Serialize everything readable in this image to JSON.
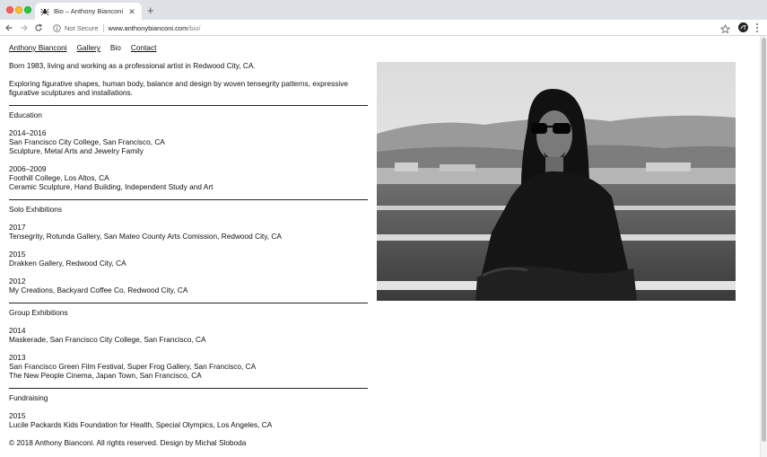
{
  "browser": {
    "tab_title": "Bio – Anthony Bianconi",
    "security_label": "Not Secure",
    "url_host": "www.anthonybianconi.com",
    "url_path": "/bio/"
  },
  "site": {
    "nav": {
      "home": "Anthony Bianconi",
      "gallery": "Gallery",
      "bio": "Bio",
      "contact": "Contact"
    },
    "intro": {
      "line1": "Born 1983, living and working as a professional artist in Redwood City, CA.",
      "line2": "Exploring figurative shapes, human body, balance and design by woven tensegrity patterns, expressive figurative sculptures and installations."
    },
    "education": {
      "heading": "Education",
      "entries": [
        {
          "years": "2014–2016",
          "school": "San Francisco City College, San Francisco, CA",
          "detail": "Sculpture, Metal Arts and Jewelry Family"
        },
        {
          "years": "2006–2009",
          "school": "Foothill College, Los Altos, CA",
          "detail": "Ceramic Sculpture, Hand Building, Independent Study and Art"
        }
      ]
    },
    "solo": {
      "heading": "Solo Exhibitions",
      "entries": [
        {
          "year": "2017",
          "item": "Tensegrity, Rotunda Gallery, San Mateo County Arts Comission, Redwood City, CA"
        },
        {
          "year": "2015",
          "item": "Drakken Gallery, Redwood City, CA"
        },
        {
          "year": "2012",
          "item": "My Creations, Backyard Coffee Co, Redwood City, CA"
        }
      ]
    },
    "group": {
      "heading": "Group Exhibitions",
      "entries": [
        {
          "year": "2014",
          "items": [
            "Maskerade, San Francisco City College, San Francisco, CA"
          ]
        },
        {
          "year": "2013",
          "items": [
            "San Francisco Green Film Festival, Super Frog Gallery, San Francisco, CA",
            "The New People Cinema, Japan Town, San Francisco, CA"
          ]
        }
      ]
    },
    "fundraising": {
      "heading": "Fundraising",
      "entries": [
        {
          "year": "2015",
          "item": "Lucile Packards Kids Foundation for Health, Special Olympics, Los Angeles, CA"
        }
      ]
    },
    "footer": "© 2018 Anthony Bianconi. All rights reserved. Design by Michal Sloboda"
  },
  "icons": {
    "favicon": "spider-icon",
    "back": "arrow-left-icon",
    "forward": "arrow-right-icon",
    "reload": "reload-icon",
    "info": "info-icon",
    "bookmark": "star-icon",
    "extension": "extension-icon",
    "menu": "kebab-menu-icon"
  }
}
